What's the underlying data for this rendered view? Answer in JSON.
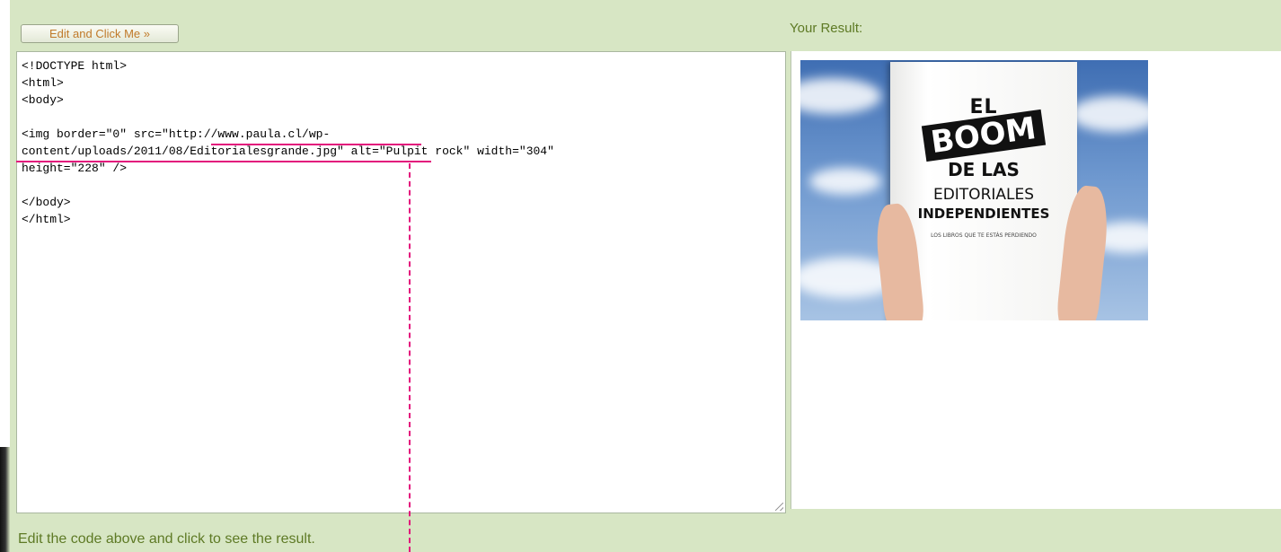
{
  "toolbar": {
    "run_label": "Edit and Click Me »"
  },
  "result": {
    "label": "Your Result:"
  },
  "editor": {
    "code": "<!DOCTYPE html>\n<html>\n<body>\n\n<img border=\"0\" src=\"http://www.paula.cl/wp-\ncontent/uploads/2011/08/Editorialesgrande.jpg\" alt=\"Pulpit rock\" width=\"304\"\nheight=\"228\" />\n\n</body>\n</html>"
  },
  "preview": {
    "alt": "Pulpit rock",
    "cover": {
      "line1": "EL",
      "line2": "BOOM",
      "line3": "DE LAS",
      "line4": "EDITORIALES",
      "line5": "INDEPENDIENTES",
      "tagline": "LOS LIBROS QUE TE ESTÁS PERDIENDO"
    }
  },
  "footer": {
    "text": "Edit the code above and click to see the result."
  },
  "colors": {
    "accent": "#e3147c",
    "panel_bg": "#d7e6c4",
    "label_green": "#5e7a25"
  }
}
